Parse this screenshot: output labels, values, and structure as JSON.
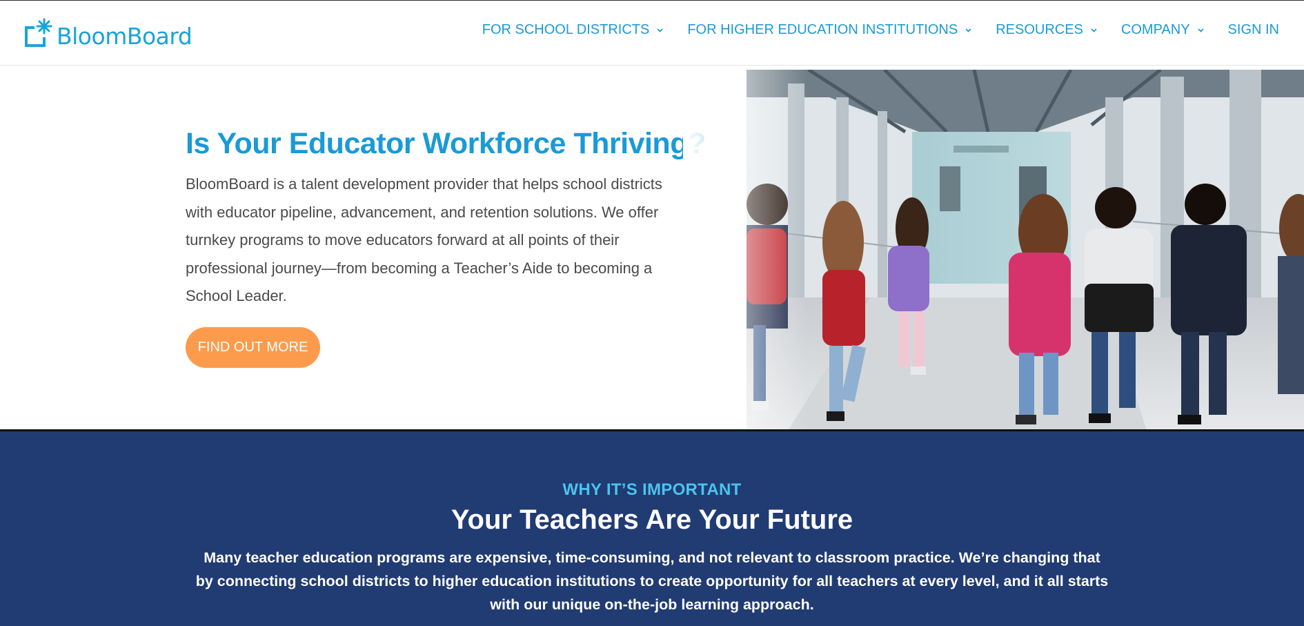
{
  "header": {
    "logo_text": "BloomBoard",
    "nav": [
      {
        "label": "FOR SCHOOL DISTRICTS",
        "has_dropdown": true
      },
      {
        "label": "FOR HIGHER EDUCATION INSTITUTIONS",
        "has_dropdown": true
      },
      {
        "label": "RESOURCES",
        "has_dropdown": true
      },
      {
        "label": "COMPANY",
        "has_dropdown": true
      },
      {
        "label": "SIGN IN",
        "has_dropdown": false
      }
    ]
  },
  "hero": {
    "title": "Is Your Educator Workforce Thriving?",
    "body": "BloomBoard is a talent development provider that helps school districts with educator pipeline, advancement, and retention solutions. We offer turnkey programs to move educators forward at all points of their professional journey—from becoming a Teacher’s Aide to becoming a School Leader.",
    "cta_label": "FIND OUT MORE",
    "image_icon": "photo-children-running-in-school-hallway"
  },
  "why": {
    "kicker": "WHY IT’S IMPORTANT",
    "title": "Your Teachers Are Your Future",
    "body": "Many teacher education programs are expensive, time-consuming, and not relevant to classroom practice. We’re changing that by connecting school districts to higher education institutions to create opportunity for all teachers at every level, and it all starts with our unique on-the-job learning approach."
  },
  "colors": {
    "brand_blue": "#1a9ad6",
    "cta_orange": "#fd9b4c",
    "section_navy": "#213b73",
    "kicker_cyan": "#4cc3ef"
  }
}
